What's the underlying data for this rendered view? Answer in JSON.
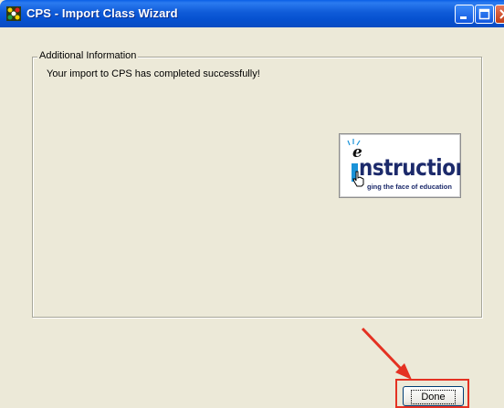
{
  "window": {
    "title": "CPS - Import Class Wizard",
    "colors": {
      "titlebar": "#0A5FE6",
      "body": "#ECE9D8",
      "close": "#C13D16"
    }
  },
  "groupbox": {
    "label": "Additional Information",
    "message": "Your import to CPS has completed successfully!"
  },
  "logo": {
    "e": "e",
    "word": "nstruction",
    "tagline": "ging the face of education",
    "icon": "einstruction-logo"
  },
  "footer": {
    "done_label": "Done",
    "highlight_color": "#E43122"
  }
}
